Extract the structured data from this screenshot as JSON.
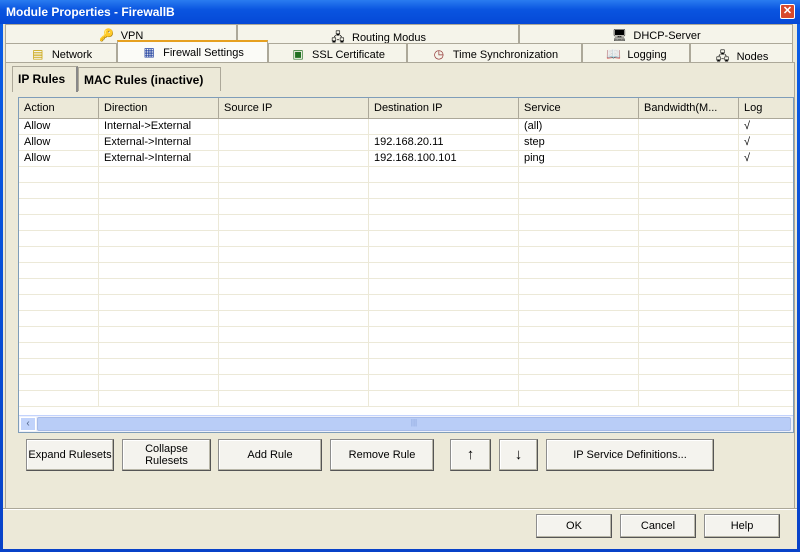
{
  "window": {
    "title": "Module Properties - FirewallB",
    "close_icon": "close-icon"
  },
  "tabs_row1": [
    {
      "label": "VPN",
      "icon": "key-icon"
    },
    {
      "label": "Routing Modus",
      "icon": "routing-computers-icon"
    },
    {
      "label": "DHCP-Server",
      "icon": "dhcp-computer-icon"
    }
  ],
  "tabs_row2": [
    {
      "label": "Network",
      "icon": "network-card-icon"
    },
    {
      "label": "Firewall Settings",
      "icon": "firewall-grid-icon",
      "selected": true
    },
    {
      "label": "SSL Certificate",
      "icon": "certificate-icon"
    },
    {
      "label": "Time Synchronization",
      "icon": "clock-icon"
    },
    {
      "label": "Logging",
      "icon": "log-book-icon"
    },
    {
      "label": "Nodes",
      "icon": "nodes-computers-icon"
    }
  ],
  "subtabs": [
    {
      "label": "IP Rules",
      "selected": true
    },
    {
      "label": "MAC Rules (inactive)"
    }
  ],
  "table": {
    "columns": [
      "Action",
      "Direction",
      "Source IP",
      "Destination IP",
      "Service",
      "Bandwidth(M...",
      "Log"
    ],
    "rows": [
      [
        "Allow",
        "Internal->External",
        "",
        "",
        "(all)",
        "",
        "√"
      ],
      [
        "Allow",
        "External->Internal",
        "",
        "192.168.20.11",
        "step",
        "",
        "√"
      ],
      [
        "Allow",
        "External->Internal",
        "",
        "192.168.100.101",
        "ping",
        "",
        "√"
      ]
    ]
  },
  "buttons": {
    "expand": "Expand Rulesets",
    "collapse": "Collapse Rulesets",
    "add": "Add Rule",
    "remove": "Remove Rule",
    "up": "↑",
    "down": "↓",
    "ip_service": "IP Service Definitions..."
  },
  "footer": {
    "ok": "OK",
    "cancel": "Cancel",
    "help": "Help"
  }
}
